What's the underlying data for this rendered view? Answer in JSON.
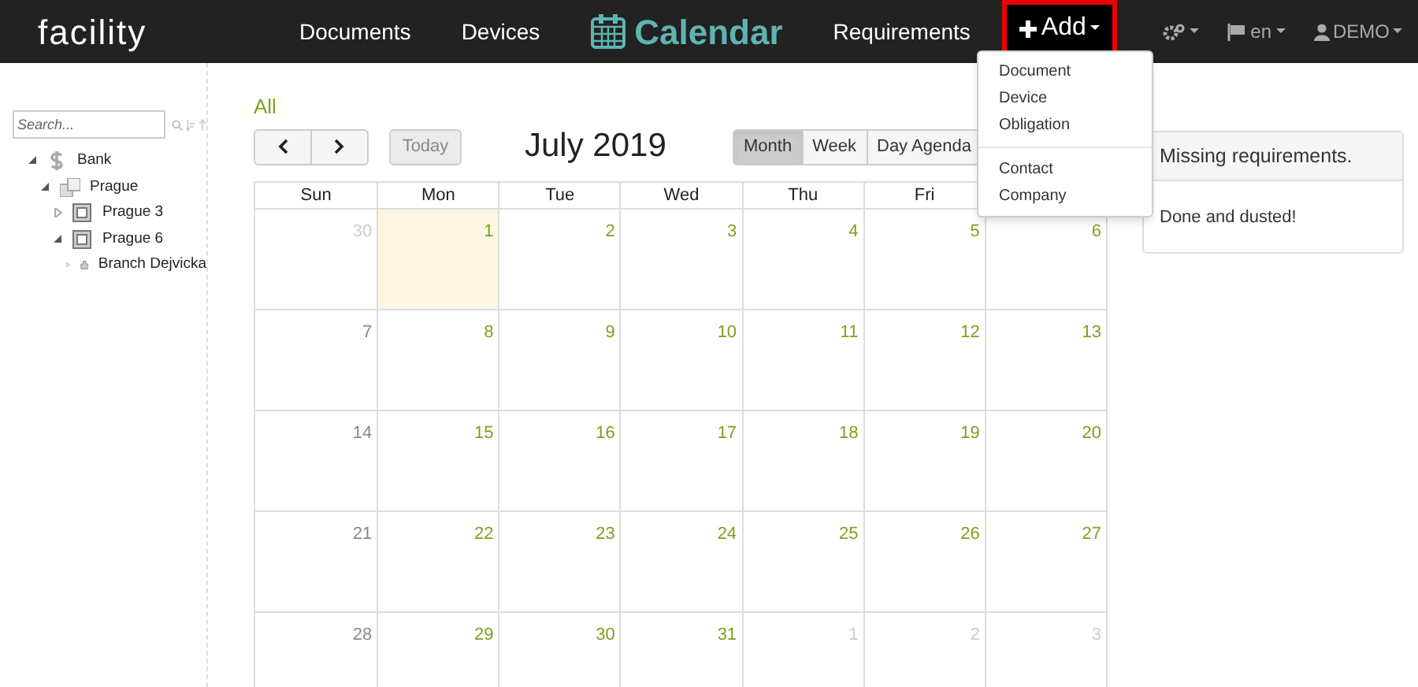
{
  "navbar": {
    "logo": "facility",
    "items": [
      {
        "label": "Documents",
        "selected": false
      },
      {
        "label": "Devices",
        "selected": false
      },
      {
        "label": "Calendar",
        "selected": true
      },
      {
        "label": "Requirements",
        "selected": false
      }
    ],
    "add_button": {
      "label": "Add",
      "expanded": true
    },
    "language": "en",
    "user": "DEMO"
  },
  "add_menu": {
    "groups": [
      [
        "Document",
        "Device",
        "Obligation"
      ],
      [
        "Contact",
        "Company"
      ]
    ]
  },
  "sidebar": {
    "search": {
      "placeholder": "Search..."
    },
    "tree": [
      {
        "label": "Bank",
        "kind": "bank",
        "expanded": true,
        "children": [
          {
            "label": "Prague",
            "kind": "city",
            "expanded": true,
            "children": [
              {
                "label": "Prague 3",
                "kind": "district",
                "expanded": false
              },
              {
                "label": "Prague 6",
                "kind": "district",
                "expanded": true,
                "children": [
                  {
                    "label": "Branch Dejvicka",
                    "kind": "branch",
                    "expanded": false
                  }
                ]
              }
            ]
          }
        ]
      }
    ]
  },
  "calendar": {
    "filter": "All",
    "today_button": {
      "label": "Today",
      "disabled": true
    },
    "title": "July 2019",
    "views": [
      {
        "label": "Month",
        "selected": true
      },
      {
        "label": "Week",
        "selected": false
      },
      {
        "label": "Day Agenda",
        "selected": false
      }
    ],
    "weekdays": [
      "Sun",
      "Mon",
      "Tue",
      "Wed",
      "Thu",
      "Fri"
    ],
    "weeks": [
      [
        {
          "day": "30",
          "other": true,
          "today": false
        },
        {
          "day": "1",
          "other": false,
          "today": true
        },
        {
          "day": "2",
          "other": false,
          "today": false
        },
        {
          "day": "3",
          "other": false,
          "today": false
        },
        {
          "day": "4",
          "other": false,
          "today": false
        },
        {
          "day": "5",
          "other": false,
          "today": false
        },
        {
          "day": "6",
          "other": false,
          "today": false
        }
      ],
      [
        {
          "day": "7",
          "other": false,
          "today": false
        },
        {
          "day": "8",
          "other": false,
          "today": false
        },
        {
          "day": "9",
          "other": false,
          "today": false
        },
        {
          "day": "10",
          "other": false,
          "today": false
        },
        {
          "day": "11",
          "other": false,
          "today": false
        },
        {
          "day": "12",
          "other": false,
          "today": false
        },
        {
          "day": "13",
          "other": false,
          "today": false
        }
      ],
      [
        {
          "day": "14",
          "other": false,
          "today": false
        },
        {
          "day": "15",
          "other": false,
          "today": false
        },
        {
          "day": "16",
          "other": false,
          "today": false
        },
        {
          "day": "17",
          "other": false,
          "today": false
        },
        {
          "day": "18",
          "other": false,
          "today": false
        },
        {
          "day": "19",
          "other": false,
          "today": false
        },
        {
          "day": "20",
          "other": false,
          "today": false
        }
      ],
      [
        {
          "day": "21",
          "other": false,
          "today": false
        },
        {
          "day": "22",
          "other": false,
          "today": false
        },
        {
          "day": "23",
          "other": false,
          "today": false
        },
        {
          "day": "24",
          "other": false,
          "today": false
        },
        {
          "day": "25",
          "other": false,
          "today": false
        },
        {
          "day": "26",
          "other": false,
          "today": false
        },
        {
          "day": "27",
          "other": false,
          "today": false
        }
      ],
      [
        {
          "day": "28",
          "other": false,
          "today": false
        },
        {
          "day": "29",
          "other": false,
          "today": false
        },
        {
          "day": "30",
          "other": false,
          "today": false
        },
        {
          "day": "31",
          "other": false,
          "today": false
        },
        {
          "day": "1",
          "other": true,
          "today": false
        },
        {
          "day": "2",
          "other": true,
          "today": false
        },
        {
          "day": "3",
          "other": true,
          "today": false
        }
      ]
    ]
  },
  "panel": {
    "title": "Missing requirements.",
    "body": "Done and dusted!"
  }
}
